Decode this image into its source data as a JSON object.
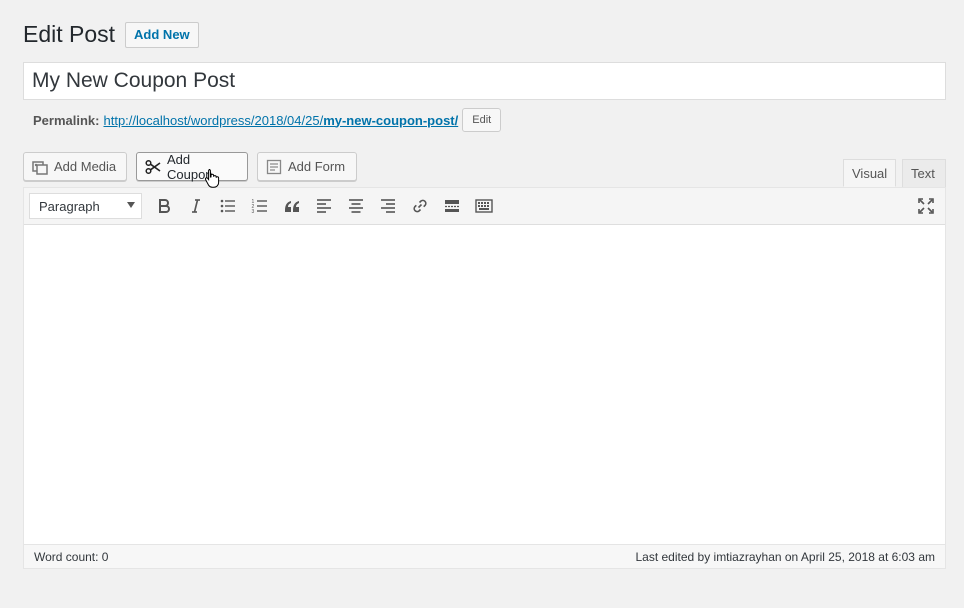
{
  "header": {
    "title": "Edit Post",
    "add_new_label": "Add New"
  },
  "post": {
    "title_value": "My New Coupon Post"
  },
  "permalink": {
    "label": "Permalink:",
    "url_base": "http://localhost/wordpress/2018/04/25/",
    "url_slug": "my-new-coupon-post/",
    "edit_label": "Edit"
  },
  "media_buttons": {
    "add_media": "Add Media",
    "add_coupon": "Add Coupon",
    "add_form": "Add Form"
  },
  "tabs": {
    "visual": "Visual",
    "text": "Text"
  },
  "toolbar": {
    "format_value": "Paragraph"
  },
  "status": {
    "word_count": "Word count: 0",
    "last_edited": "Last edited by imtiazrayhan on April 25, 2018 at 6:03 am"
  },
  "colors": {
    "link": "#0073aa",
    "background": "#f1f1f1"
  }
}
